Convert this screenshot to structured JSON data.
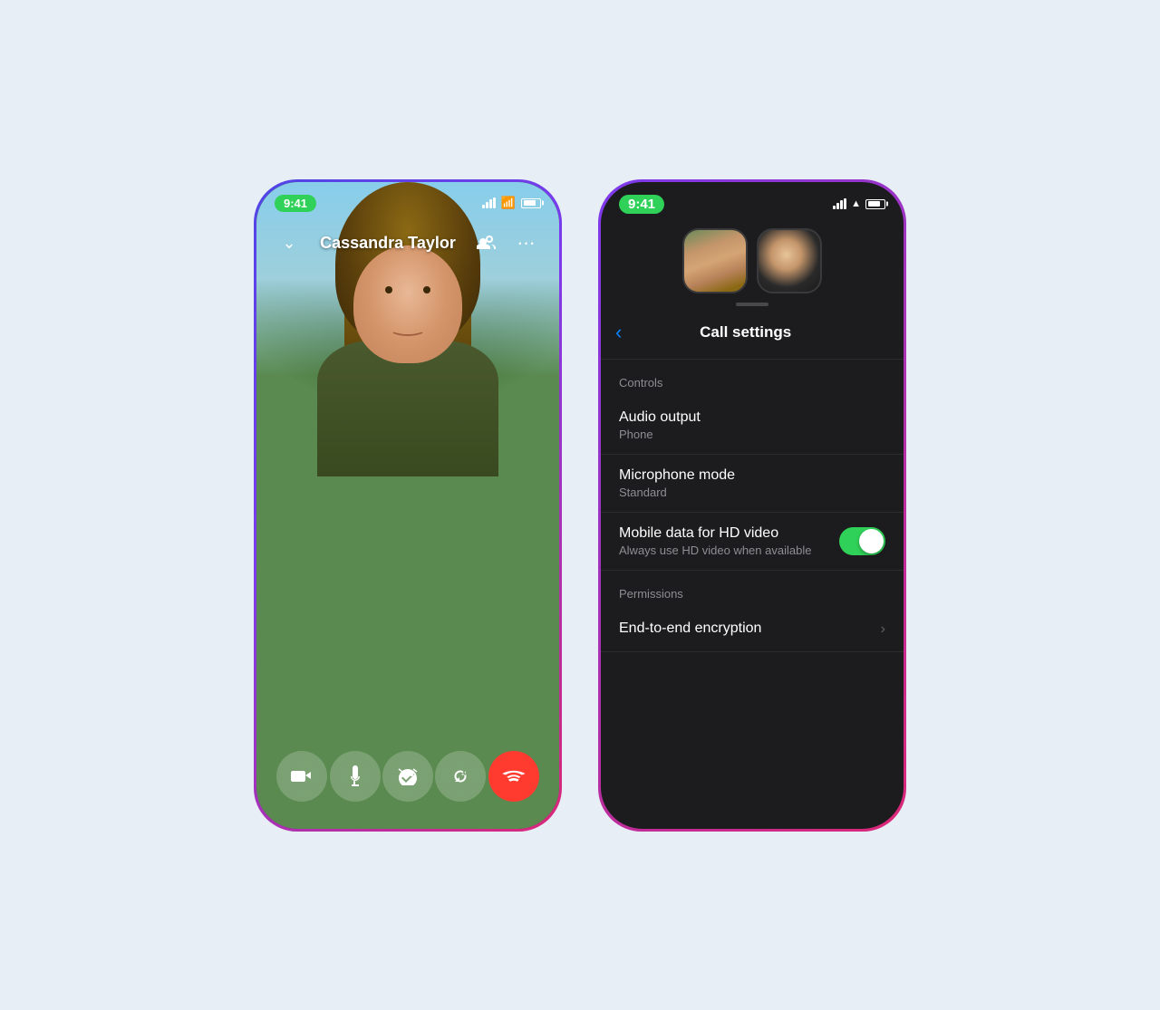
{
  "page": {
    "background_color": "#e8eef5"
  },
  "left_phone": {
    "status_bar": {
      "time": "9:41",
      "gradient_border": "linear-gradient(135deg, #4f46e5, #7c3aed, #db2777)"
    },
    "call": {
      "caller_name": "Cassandra Taylor",
      "add_person_label": "add person",
      "more_label": "more options",
      "back_label": "back"
    },
    "controls": {
      "video_label": "video",
      "mic_label": "microphone",
      "effects_label": "effects",
      "flip_label": "flip camera",
      "end_call_label": "end call"
    }
  },
  "right_phone": {
    "status_bar": {
      "time": "9:41",
      "gradient_border": "linear-gradient(135deg, #7c3aed, #db2777)"
    },
    "settings": {
      "title": "Call settings",
      "back_label": "back",
      "sections": [
        {
          "header": "Controls",
          "rows": [
            {
              "title": "Audio output",
              "subtitle": "Phone",
              "type": "navigate"
            },
            {
              "title": "Microphone mode",
              "subtitle": "Standard",
              "type": "navigate"
            },
            {
              "title": "Mobile data for HD video",
              "subtitle": "Always use HD video when available",
              "type": "toggle",
              "value": true
            }
          ]
        },
        {
          "header": "Permissions",
          "rows": [
            {
              "title": "End-to-end encryption",
              "subtitle": "",
              "type": "navigate"
            }
          ]
        }
      ]
    }
  }
}
